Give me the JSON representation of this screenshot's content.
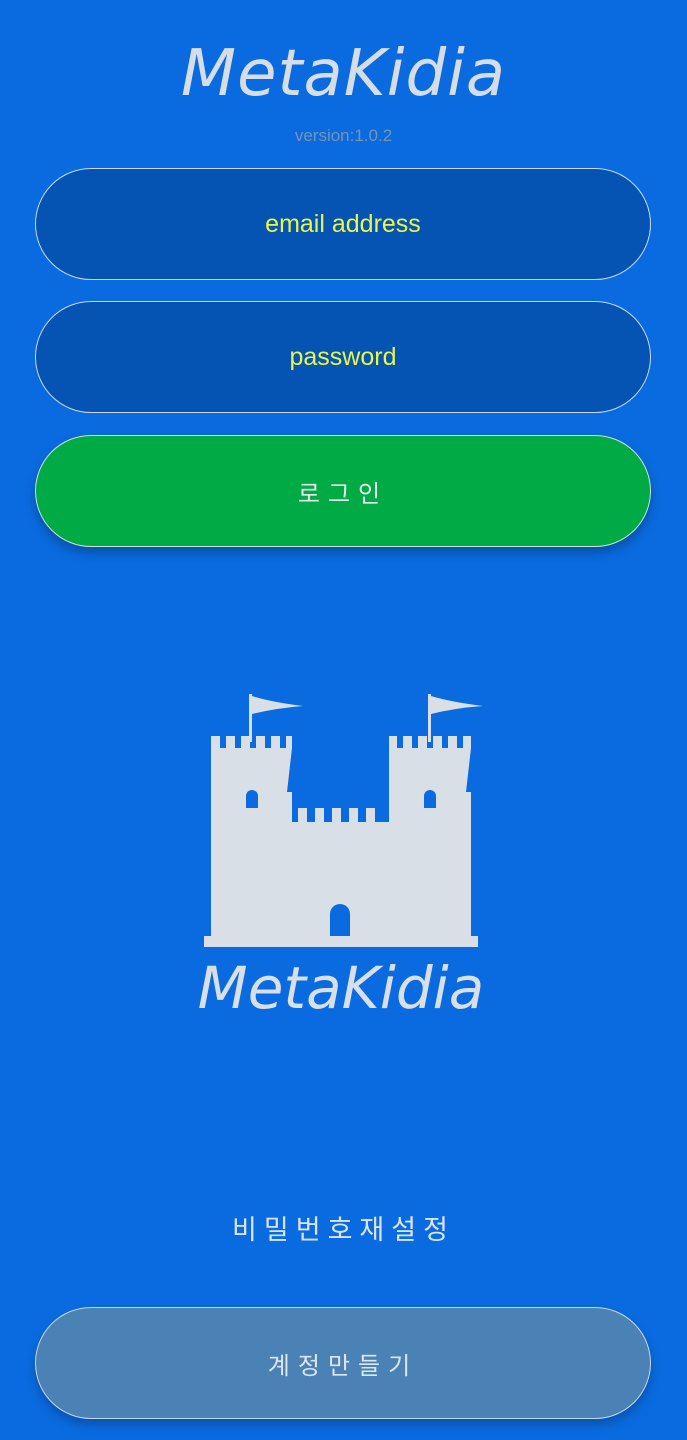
{
  "header": {
    "app_title": "MetaKidia",
    "version": "version:1.0.2"
  },
  "form": {
    "email_placeholder": "email address",
    "email_value": "",
    "password_placeholder": "password",
    "password_value": "",
    "login_label": "로그인"
  },
  "logo": {
    "icon": "castle-icon",
    "wordmark": "MetaKidia"
  },
  "footer": {
    "reset_password_label": "비밀번호재설정",
    "create_account_label": "계정만들기"
  },
  "colors": {
    "background": "#0a6be0",
    "field_background": "#0554b3",
    "placeholder_text": "#e8f54a",
    "login_button": "#00aa45",
    "signup_button": "#4a82b6",
    "logo_fill": "#d9dfe7"
  }
}
